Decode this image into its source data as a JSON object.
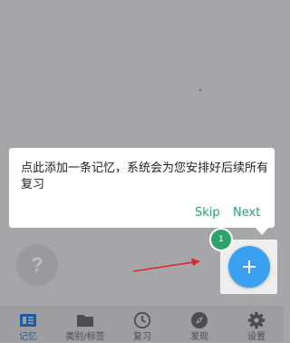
{
  "tooltip": {
    "message": "点此添加一条记忆，系统会为您安排好后续所有复习",
    "skip_label": "Skip",
    "next_label": "Next"
  },
  "step_badge": "1",
  "help_button": {
    "label": "?"
  },
  "fab": {
    "icon": "plus-icon"
  },
  "bottom_nav": {
    "items": [
      {
        "label": "记忆",
        "icon": "memory-card-icon",
        "active": true
      },
      {
        "label": "类别/标签",
        "icon": "folder-icon",
        "active": false
      },
      {
        "label": "复习",
        "icon": "clock-icon",
        "active": false
      },
      {
        "label": "发现",
        "icon": "compass-icon",
        "active": false
      },
      {
        "label": "设置",
        "icon": "gear-icon",
        "active": false
      }
    ]
  },
  "colors": {
    "overlay": "#a6a5a8",
    "accent_green": "#2e9c7d",
    "badge_green": "#2ea36a",
    "fab_blue": "#3aa0f0",
    "active_nav": "#1c5fa8",
    "arrow_red": "#d8262b"
  }
}
